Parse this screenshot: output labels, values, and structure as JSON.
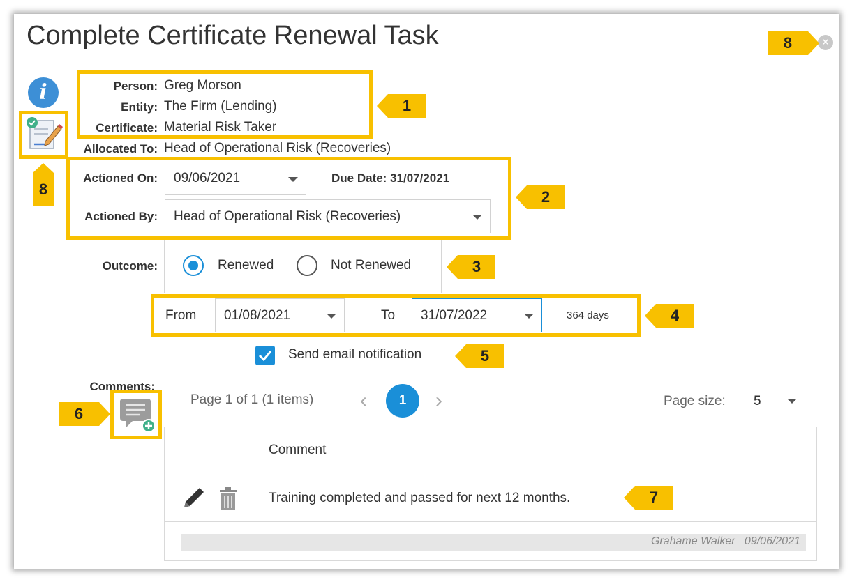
{
  "dialog": {
    "title": "Complete Certificate Renewal Task",
    "close_glyph": "×"
  },
  "info": {
    "info_glyph": "i",
    "person_label": "Person:",
    "person_value": "Greg Morson",
    "entity_label": "Entity:",
    "entity_value": "The Firm (Lending)",
    "certificate_label": "Certificate:",
    "certificate_value": "Material Risk Taker",
    "allocated_label": "Allocated To:",
    "allocated_value": "Head of Operational Risk (Recoveries)"
  },
  "action": {
    "actioned_on_label": "Actioned On:",
    "actioned_on_value": "09/06/2021",
    "due_date_text": "Due Date: 31/07/2021",
    "actioned_by_label": "Actioned By:",
    "actioned_by_value": "Head of Operational Risk (Recoveries)"
  },
  "outcome": {
    "label": "Outcome:",
    "options": [
      "Renewed",
      "Not Renewed"
    ],
    "selected": "Renewed"
  },
  "period": {
    "from_label": "From",
    "from_value": "01/08/2021",
    "to_label": "To",
    "to_value": "31/07/2022",
    "duration": "364 days"
  },
  "notify": {
    "label": "Send email notification",
    "checked": true
  },
  "comments": {
    "label": "Comments:",
    "pager_text": "Page 1 of 1 (1 items)",
    "current_page": "1",
    "prev_glyph": "‹",
    "next_glyph": "›",
    "page_size_label": "Page size:",
    "page_size_value": "5",
    "column_header": "Comment",
    "rows": [
      {
        "text": "Training completed and passed for next 12 months.",
        "author": "Grahame Walker",
        "date": "09/06/2021"
      }
    ]
  },
  "callouts": [
    "1",
    "2",
    "3",
    "4",
    "5",
    "6",
    "7",
    "8",
    "8"
  ],
  "colors": {
    "highlight": "#f8c000",
    "accent": "#1a8fd8",
    "info": "#3d8fd6"
  }
}
